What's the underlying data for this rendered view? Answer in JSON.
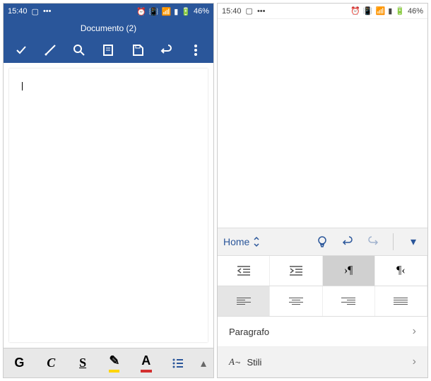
{
  "status": {
    "time": "15:40",
    "battery": "46%"
  },
  "left": {
    "title": "Documento (2)",
    "doc_cursor": "|",
    "format": {
      "bold": "G",
      "italic": "C",
      "underline": "S",
      "highlight_glyph": "✎",
      "font_color_glyph": "A"
    }
  },
  "right": {
    "ribbon_tab": "Home",
    "rows": {
      "paragraph": "Paragrafo",
      "styles": "Stili"
    }
  }
}
